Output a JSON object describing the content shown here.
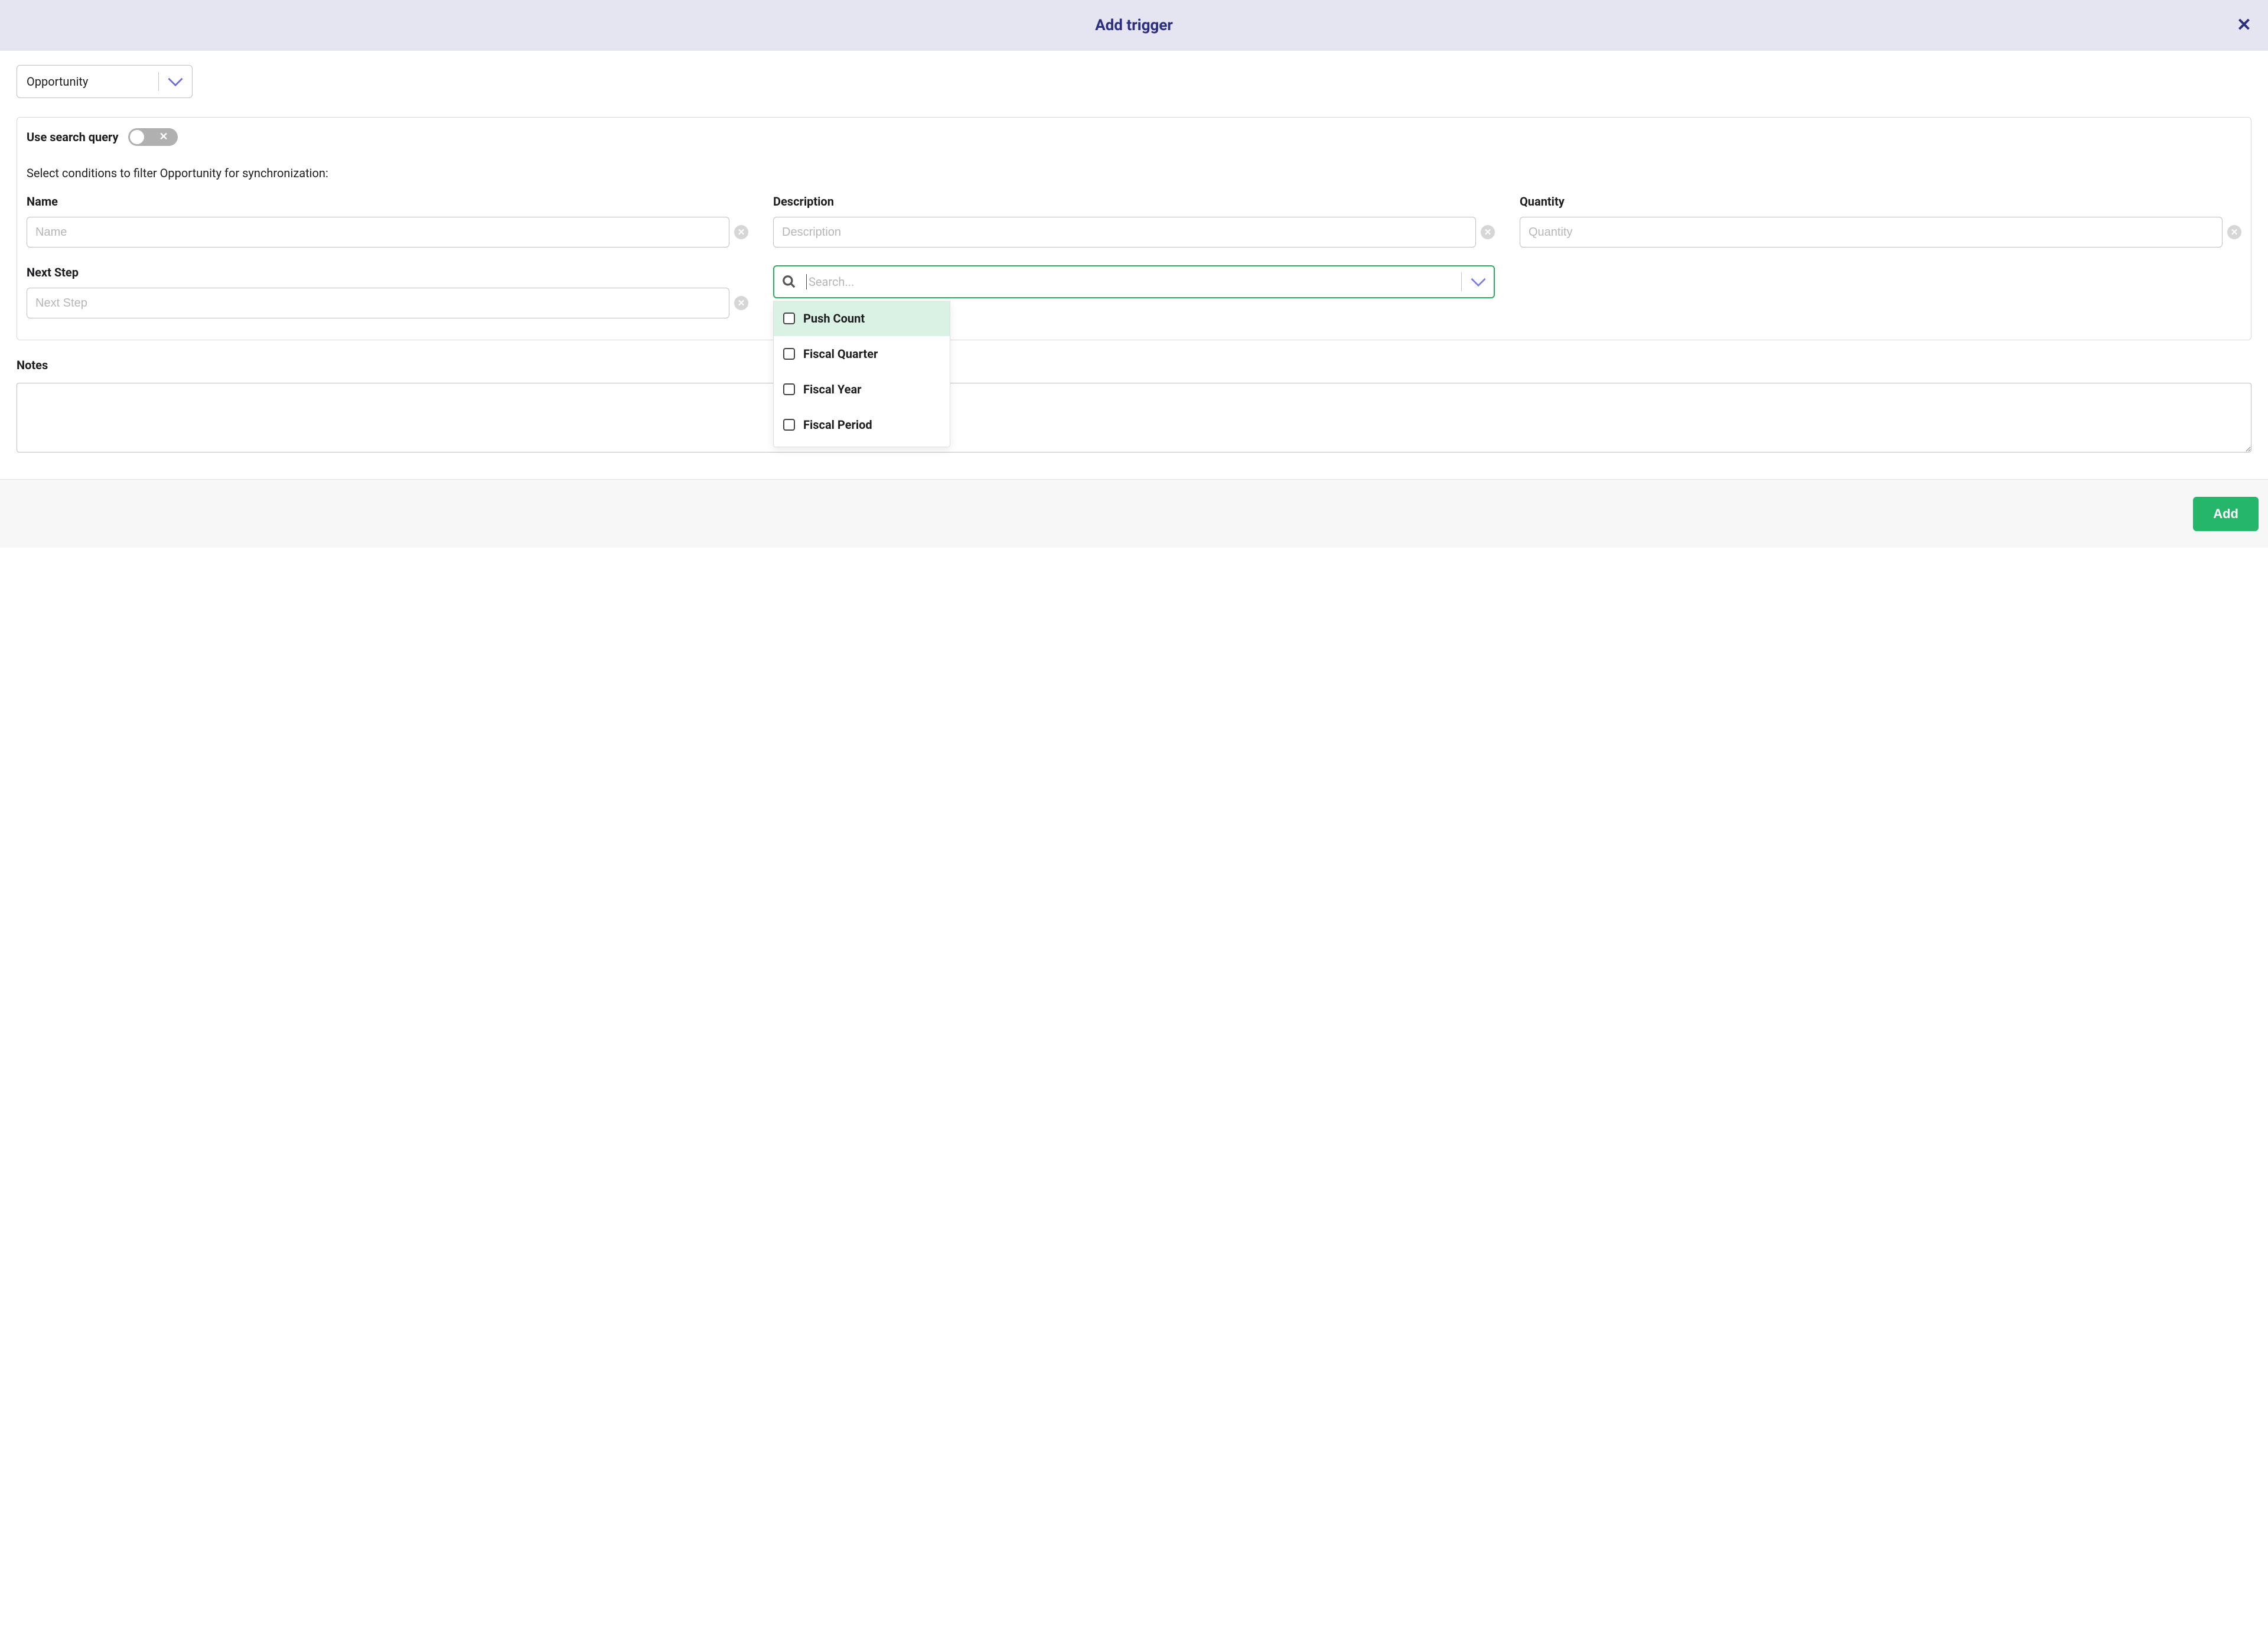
{
  "modal": {
    "title": "Add trigger",
    "close_symbol": "✕"
  },
  "entity_select": {
    "value": "Opportunity"
  },
  "query_toggle": {
    "label": "Use search query",
    "state": "off",
    "off_symbol": "✕"
  },
  "instruction": "Select conditions to filter Opportunity for synchronization:",
  "fields": {
    "name": {
      "label": "Name",
      "placeholder": "Name",
      "value": ""
    },
    "description": {
      "label": "Description",
      "placeholder": "Description",
      "value": ""
    },
    "quantity": {
      "label": "Quantity",
      "placeholder": "Quantity",
      "value": ""
    },
    "next_step": {
      "label": "Next Step",
      "placeholder": "Next Step",
      "value": ""
    }
  },
  "search_select": {
    "placeholder": "Search...",
    "options": [
      {
        "label": "Push Count",
        "checked": false,
        "highlight": true
      },
      {
        "label": "Fiscal Quarter",
        "checked": false,
        "highlight": false
      },
      {
        "label": "Fiscal Year",
        "checked": false,
        "highlight": false
      },
      {
        "label": "Fiscal Period",
        "checked": false,
        "highlight": false
      }
    ]
  },
  "notes": {
    "label": "Notes",
    "value": ""
  },
  "footer": {
    "add_label": "Add"
  },
  "clear_symbol": "✕"
}
